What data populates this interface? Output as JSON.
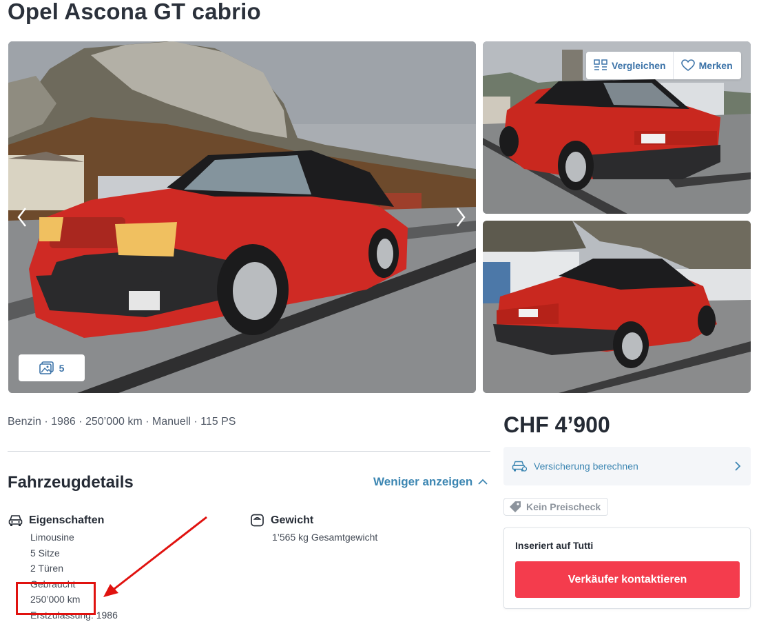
{
  "title": "Opel Ascona GT cabrio",
  "gallery": {
    "photo_count": "5"
  },
  "actions": {
    "compare": "Vergleichen",
    "save": "Merken"
  },
  "summary": "Benzin · 1986 · 250’000 km · Manuell · 115 PS",
  "details": {
    "title": "Fahrzeugdetails",
    "toggle_label": "Weniger anzeigen",
    "properties": {
      "title": "Eigenschaften",
      "items": [
        "Limousine",
        "5 Sitze",
        "2 Türen",
        "Gebraucht",
        "250’000 km",
        "Erstzulassung: 1986"
      ]
    },
    "weight": {
      "title": "Gewicht",
      "items": [
        "1’565 kg Gesamtgewicht"
      ]
    }
  },
  "price": "CHF 4’900",
  "insurance_label": "Versicherung berechnen",
  "price_check": "Kein Preischeck",
  "seller": {
    "heading": "Inseriert auf Tutti",
    "contact_button": "Verkäufer kontaktieren"
  },
  "colors": {
    "accent": "#3c86b2",
    "contact": "#f43c4d",
    "car_red": "#cf2a24",
    "annotation": "#e0120f"
  },
  "icons": {
    "prev": "chevron-left-icon",
    "next": "chevron-right-icon",
    "gallery": "image-stack-icon",
    "compare": "compare-icon",
    "save": "heart-icon",
    "car": "car-icon",
    "weight": "scale-icon",
    "insurance": "car-insurance-icon",
    "tag": "tag-icon"
  }
}
